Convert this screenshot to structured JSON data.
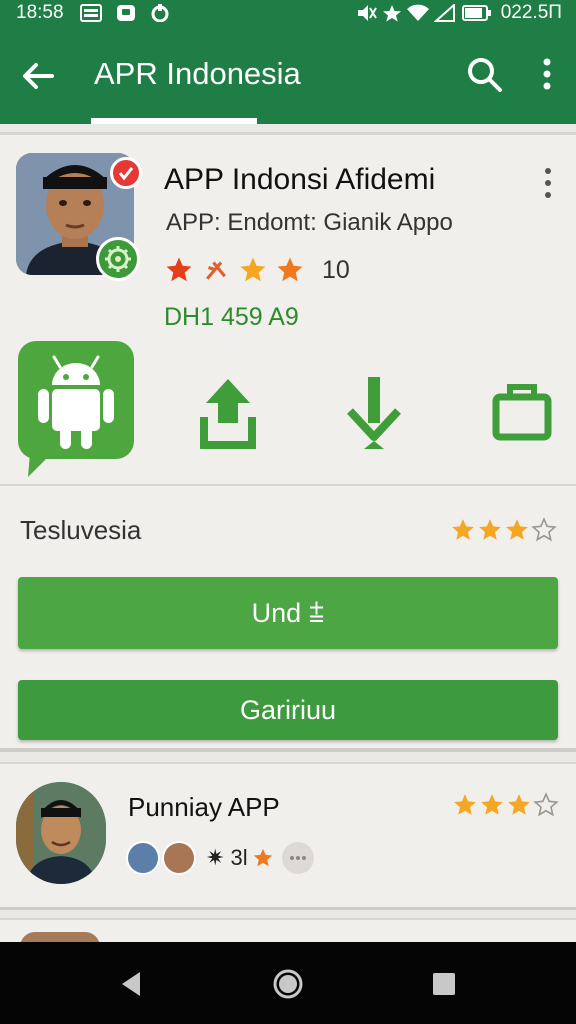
{
  "status_bar": {
    "time": "18:58",
    "right_text": "022.5Π",
    "icons": [
      "sim-icon",
      "notification-icon",
      "sync-icon",
      "mute-icon",
      "star-icon",
      "wifi-icon",
      "signal-icon",
      "battery-icon"
    ]
  },
  "app_bar": {
    "title": "APR Indonesia",
    "icons": [
      "back-arrow-icon",
      "search-icon",
      "more-vert-icon"
    ]
  },
  "app_card": {
    "name": "APP Indonsi Afidemi",
    "subtitle": "APP: Endomt: Gianik Appo",
    "rating_value": 3.5,
    "rating_count": "10",
    "code": "DH1 459 A9",
    "actions": [
      "upload-icon",
      "download-icon",
      "briefcase-icon"
    ],
    "section_label": "Tesluvesia",
    "section_rating": 3.5,
    "primary_button": "Und ⩲",
    "secondary_button": "Gaririuu"
  },
  "list_item": {
    "title": "Punniay APP",
    "rating": 3.5,
    "reviewers_text": "✷ 3l"
  },
  "colors": {
    "brand_green": "#1e7e45",
    "button_green": "#4ba643",
    "star_orange": "#f5a623",
    "star_red": "#e53e1a",
    "code_green": "#2e8b2c"
  }
}
